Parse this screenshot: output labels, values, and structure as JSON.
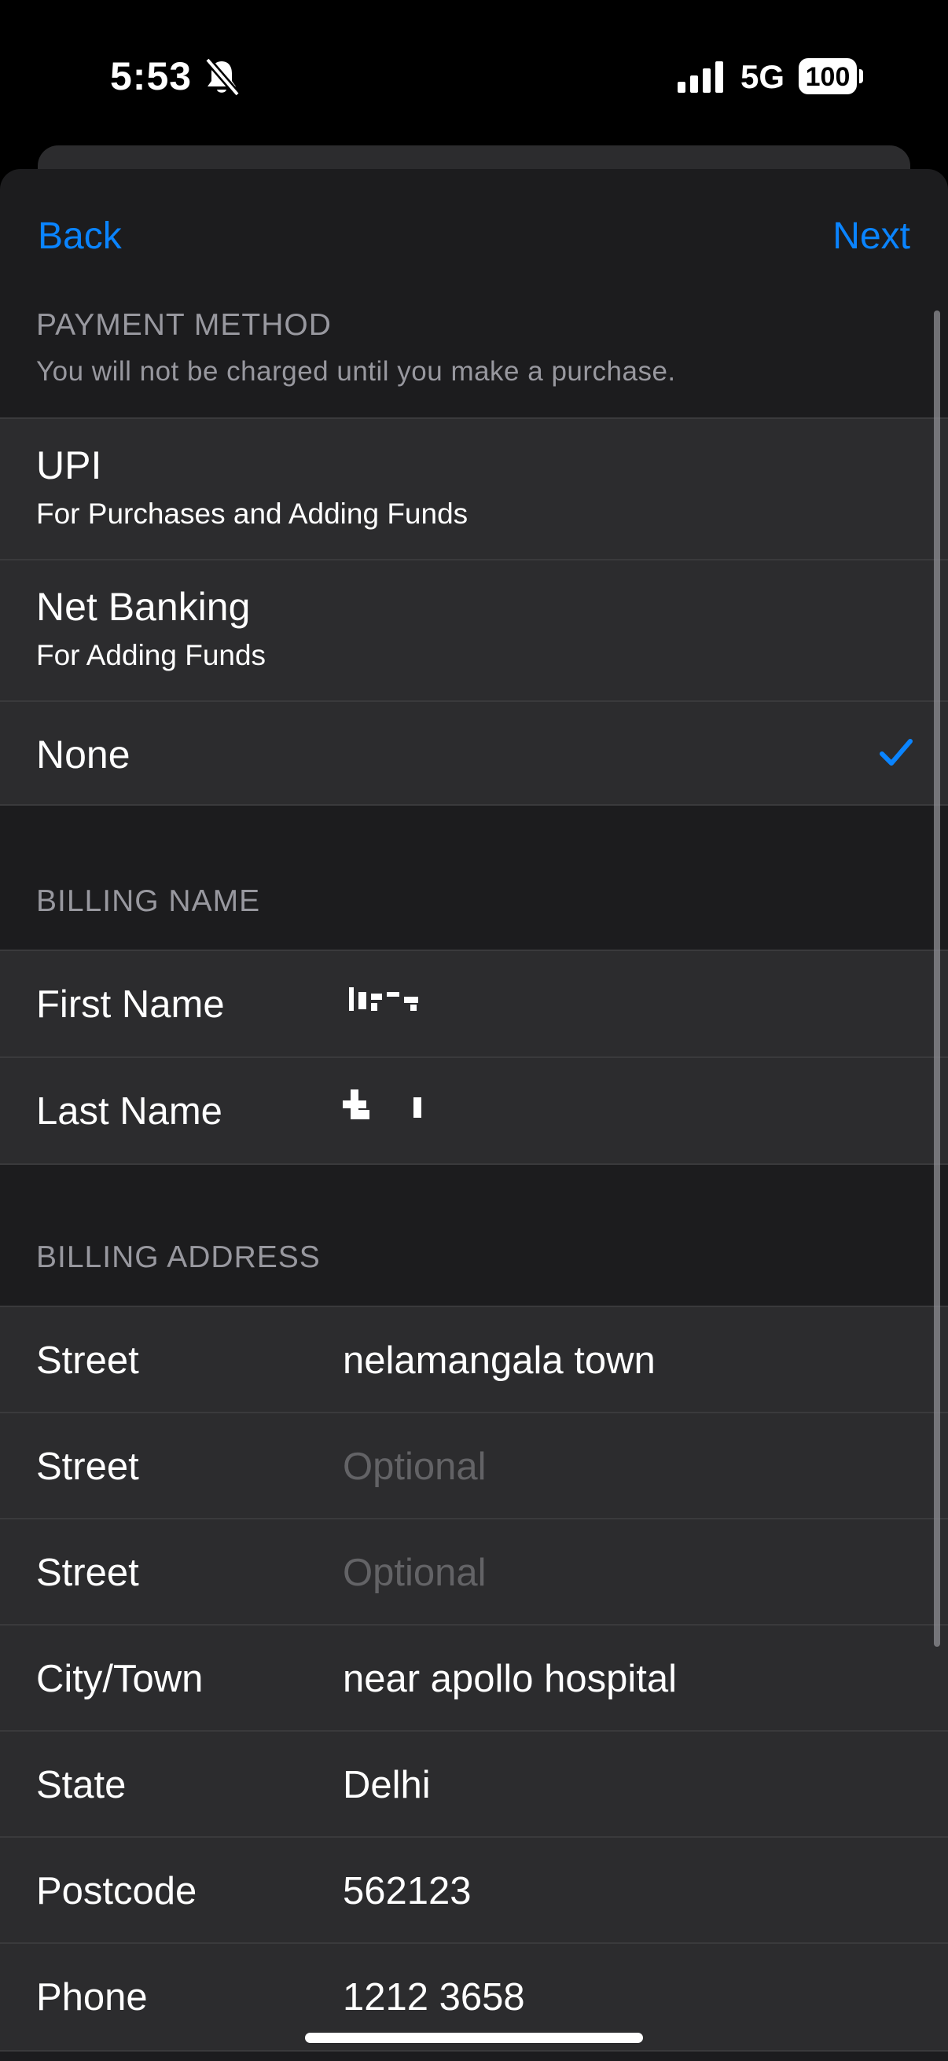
{
  "status_bar": {
    "time": "5:53",
    "network": "5G",
    "battery": "100",
    "icons": [
      "bell-slash-icon",
      "signal-icon",
      "battery-icon"
    ]
  },
  "nav": {
    "back_label": "Back",
    "next_label": "Next"
  },
  "payment": {
    "header": "PAYMENT METHOD",
    "subtitle": "You will not be charged until you make a purchase.",
    "options": [
      {
        "title": "UPI",
        "subtitle": "For Purchases and Adding Funds",
        "selected": false
      },
      {
        "title": "Net Banking",
        "subtitle": "For Adding Funds",
        "selected": false
      },
      {
        "title": "None",
        "selected": true
      }
    ]
  },
  "billing_name": {
    "header": "BILLING NAME",
    "first_label": "First Name",
    "last_label": "Last Name"
  },
  "billing_address": {
    "header": "BILLING ADDRESS",
    "street1_label": "Street",
    "street1_value": "nelamangala town",
    "street2_label": "Street",
    "street2_placeholder": "Optional",
    "street3_label": "Street",
    "street3_placeholder": "Optional",
    "city_label": "City/Town",
    "city_value": "near apollo hospital",
    "state_label": "State",
    "state_value": "Delhi",
    "postcode_label": "Postcode",
    "postcode_value": "562123",
    "phone_label": "Phone",
    "phone_value": "1212 3658"
  },
  "colors": {
    "accent": "#0a84ff",
    "sheet": "#1c1c1e",
    "cell": "#2c2c2e",
    "secondary_text": "#98989f"
  }
}
